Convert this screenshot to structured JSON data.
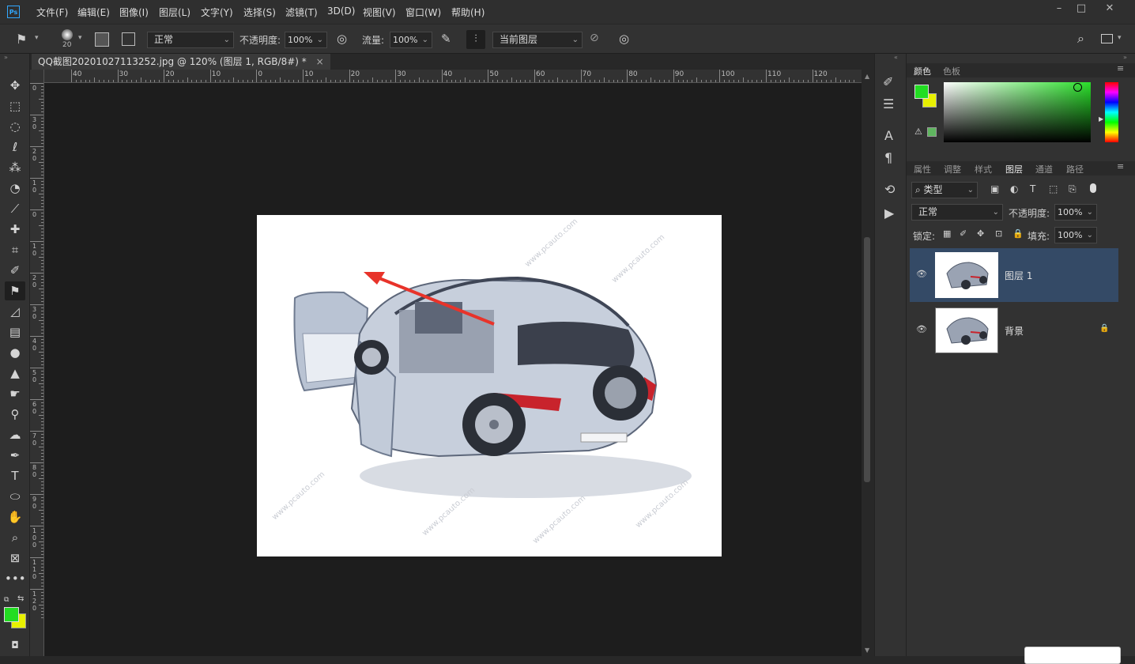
{
  "app": {
    "logo": "Ps"
  },
  "menu": {
    "items": [
      "文件(F)",
      "编辑(E)",
      "图像(I)",
      "图层(L)",
      "文字(Y)",
      "选择(S)",
      "滤镜(T)",
      "3D(D)",
      "视图(V)",
      "窗口(W)",
      "帮助(H)"
    ]
  },
  "window_controls": {
    "minimize": "–",
    "maximize": "□",
    "close": "✕"
  },
  "options": {
    "brush_size": "20",
    "mode": "正常",
    "opacity_label": "不透明度:",
    "opacity_value": "100%",
    "flow_label": "流量:",
    "flow_value": "100%",
    "sample": "当前图层"
  },
  "document": {
    "tab_title": "QQ截图20201027113252.jpg @ 120% (图层 1, RGB/8#) *",
    "tab_close": "×"
  },
  "ruler": {
    "h_labels": [
      "40",
      "30",
      "20",
      "10",
      "0",
      "10",
      "20",
      "30",
      "40",
      "50",
      "60",
      "70",
      "80",
      "90",
      "100",
      "110",
      "120"
    ],
    "v_labels": [
      "0",
      "3\n0",
      "2\n0",
      "1\n0",
      "0",
      "1\n0",
      "2\n0",
      "3\n0",
      "4\n0",
      "5\n0",
      "6\n0",
      "7\n0",
      "8\n0",
      "9\n0",
      "1\n0\n0",
      "1\n1\n0",
      "1\n2\n0"
    ]
  },
  "image_watermark": "www.pcauto.com",
  "colors": {
    "foreground": "#22dd22",
    "background": "#e8f000",
    "selection_blue": "#344a66",
    "arrow_red": "#e8332a"
  },
  "color_panel": {
    "tabs": [
      "颜色",
      "色板"
    ]
  },
  "layers_panel": {
    "tabs": [
      "属性",
      "调整",
      "样式",
      "图层",
      "通道",
      "路径"
    ],
    "filter_kind": "类型",
    "blend_mode": "正常",
    "opacity_label": "不透明度:",
    "opacity_value": "100%",
    "lock_label": "锁定:",
    "fill_label": "填充:",
    "fill_value": "100%",
    "layers": [
      {
        "name": "图层 1",
        "selected": true,
        "locked": false
      },
      {
        "name": "背景",
        "selected": false,
        "locked": true
      }
    ]
  }
}
